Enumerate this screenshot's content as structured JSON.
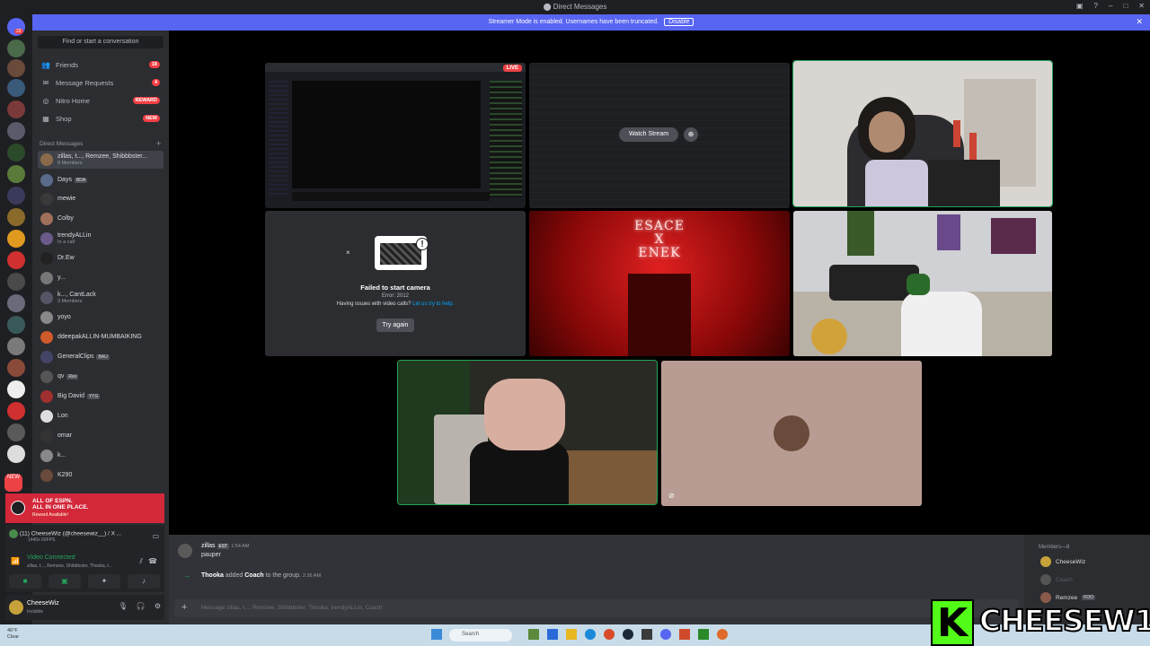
{
  "window": {
    "title": "Direct Messages"
  },
  "banner": {
    "text": "Streamer Mode is enabled. Usernames have been truncated.",
    "button": "Disable"
  },
  "servers": {
    "home_badge": "22",
    "new_label": "NEW"
  },
  "sidebar": {
    "search_placeholder": "Find or start a conversation",
    "nav": [
      {
        "label": "Friends",
        "icon": "friends-icon",
        "badge": "18"
      },
      {
        "label": "Message Requests",
        "icon": "mail-icon",
        "badge": "4"
      },
      {
        "label": "Nitro Home",
        "icon": "nitro-icon",
        "badge": "REWARD"
      },
      {
        "label": "Shop",
        "icon": "shop-icon",
        "badge": "NEW"
      }
    ],
    "dm_header": "Direct Messages",
    "dms": [
      {
        "name": "zillas, t..., Remzee, Shibbbster...",
        "sub": "8 Members",
        "color": "#8a6a4a"
      },
      {
        "name": "Days",
        "tag": "BDA",
        "sub": "",
        "color": "#5a6a8a"
      },
      {
        "name": "mewie",
        "sub": "",
        "color": "#3a3a3a"
      },
      {
        "name": "Colby",
        "sub": "",
        "color": "#a0705a"
      },
      {
        "name": "trendyALLin",
        "sub": "In a call",
        "color": "#6a5a8a"
      },
      {
        "name": "Dr.Ew",
        "sub": "",
        "color": "#222"
      },
      {
        "name": "y...",
        "sub": "",
        "color": "#777"
      },
      {
        "name": "k..., CantLack",
        "sub": "3 Members",
        "color": "#556"
      },
      {
        "name": "yoyo",
        "sub": "",
        "color": "#888"
      },
      {
        "name": "ddeepakALLIN-MUMBAIKING",
        "sub": "",
        "color": "#d05a2a"
      },
      {
        "name": "GeneralClips",
        "tag": "BAU",
        "sub": "",
        "color": "#446"
      },
      {
        "name": "qv",
        "tag": "Rex",
        "sub": "",
        "color": "#555"
      },
      {
        "name": "Big David",
        "tag": "YTG",
        "sub": "",
        "color": "#a03030"
      },
      {
        "name": "Lon",
        "sub": "",
        "color": "#ddd"
      },
      {
        "name": "omar",
        "sub": "",
        "color": "#333"
      },
      {
        "name": "k...",
        "sub": "",
        "color": "#888"
      },
      {
        "name": "K290",
        "sub": "",
        "color": "#6a4a3a"
      }
    ]
  },
  "promo": {
    "line1": "ALL OF ESPN.",
    "line2": "ALL IN ONE PLACE.",
    "sub": "Reward Available!"
  },
  "voice": {
    "stream_title": "(11) CheeseWiz (@cheesewiz__) / X ...",
    "stream_sub": "1440x 60FPS",
    "status": "Video Connected",
    "members": "zillas, t..., Remzee, Shibbbster, Thooka, t...",
    "buttons": [
      "camera-icon",
      "screen-share-icon",
      "activity-icon",
      "soundboard-icon"
    ]
  },
  "user": {
    "name": "CheeseWiz",
    "status": "Invisible"
  },
  "stage": {
    "watch_stream": "Watch Stream",
    "live": "LIVE",
    "failed_title": "Failed to start camera",
    "failed_error": "Error: 2012",
    "failed_help": "Having issues with video calls?",
    "failed_link": "Let us try to help.",
    "try_again": "Try again",
    "neon_line1": "ESACE",
    "neon_line2": "X",
    "neon_line3": "ENEK"
  },
  "chat": {
    "author": "zillas",
    "author_tag": "EST",
    "time": "1:54 AM",
    "text": "pauper",
    "system_actor": "Thooka",
    "system_mid": " added ",
    "system_target": "Coach",
    "system_end": " to the group.",
    "system_time": "2:26 AM",
    "input_placeholder": "Message zillas, t..., Remzee, Shibbbster, Thooka, trendyALLin, Coach"
  },
  "members_panel": {
    "header": "Members—8",
    "list": [
      {
        "name": "CheeseWiz",
        "color": "#c7a23a"
      },
      {
        "name": "Coach",
        "color": "#555"
      },
      {
        "name": "Remzee",
        "tag": "FOO",
        "color": "#8a5a4a"
      }
    ]
  },
  "taskbar": {
    "weather": "46°F",
    "weather_sub": "Clear",
    "search": "Search"
  },
  "watermark": {
    "text": "CHEESEW1Z",
    "letter": "K"
  }
}
